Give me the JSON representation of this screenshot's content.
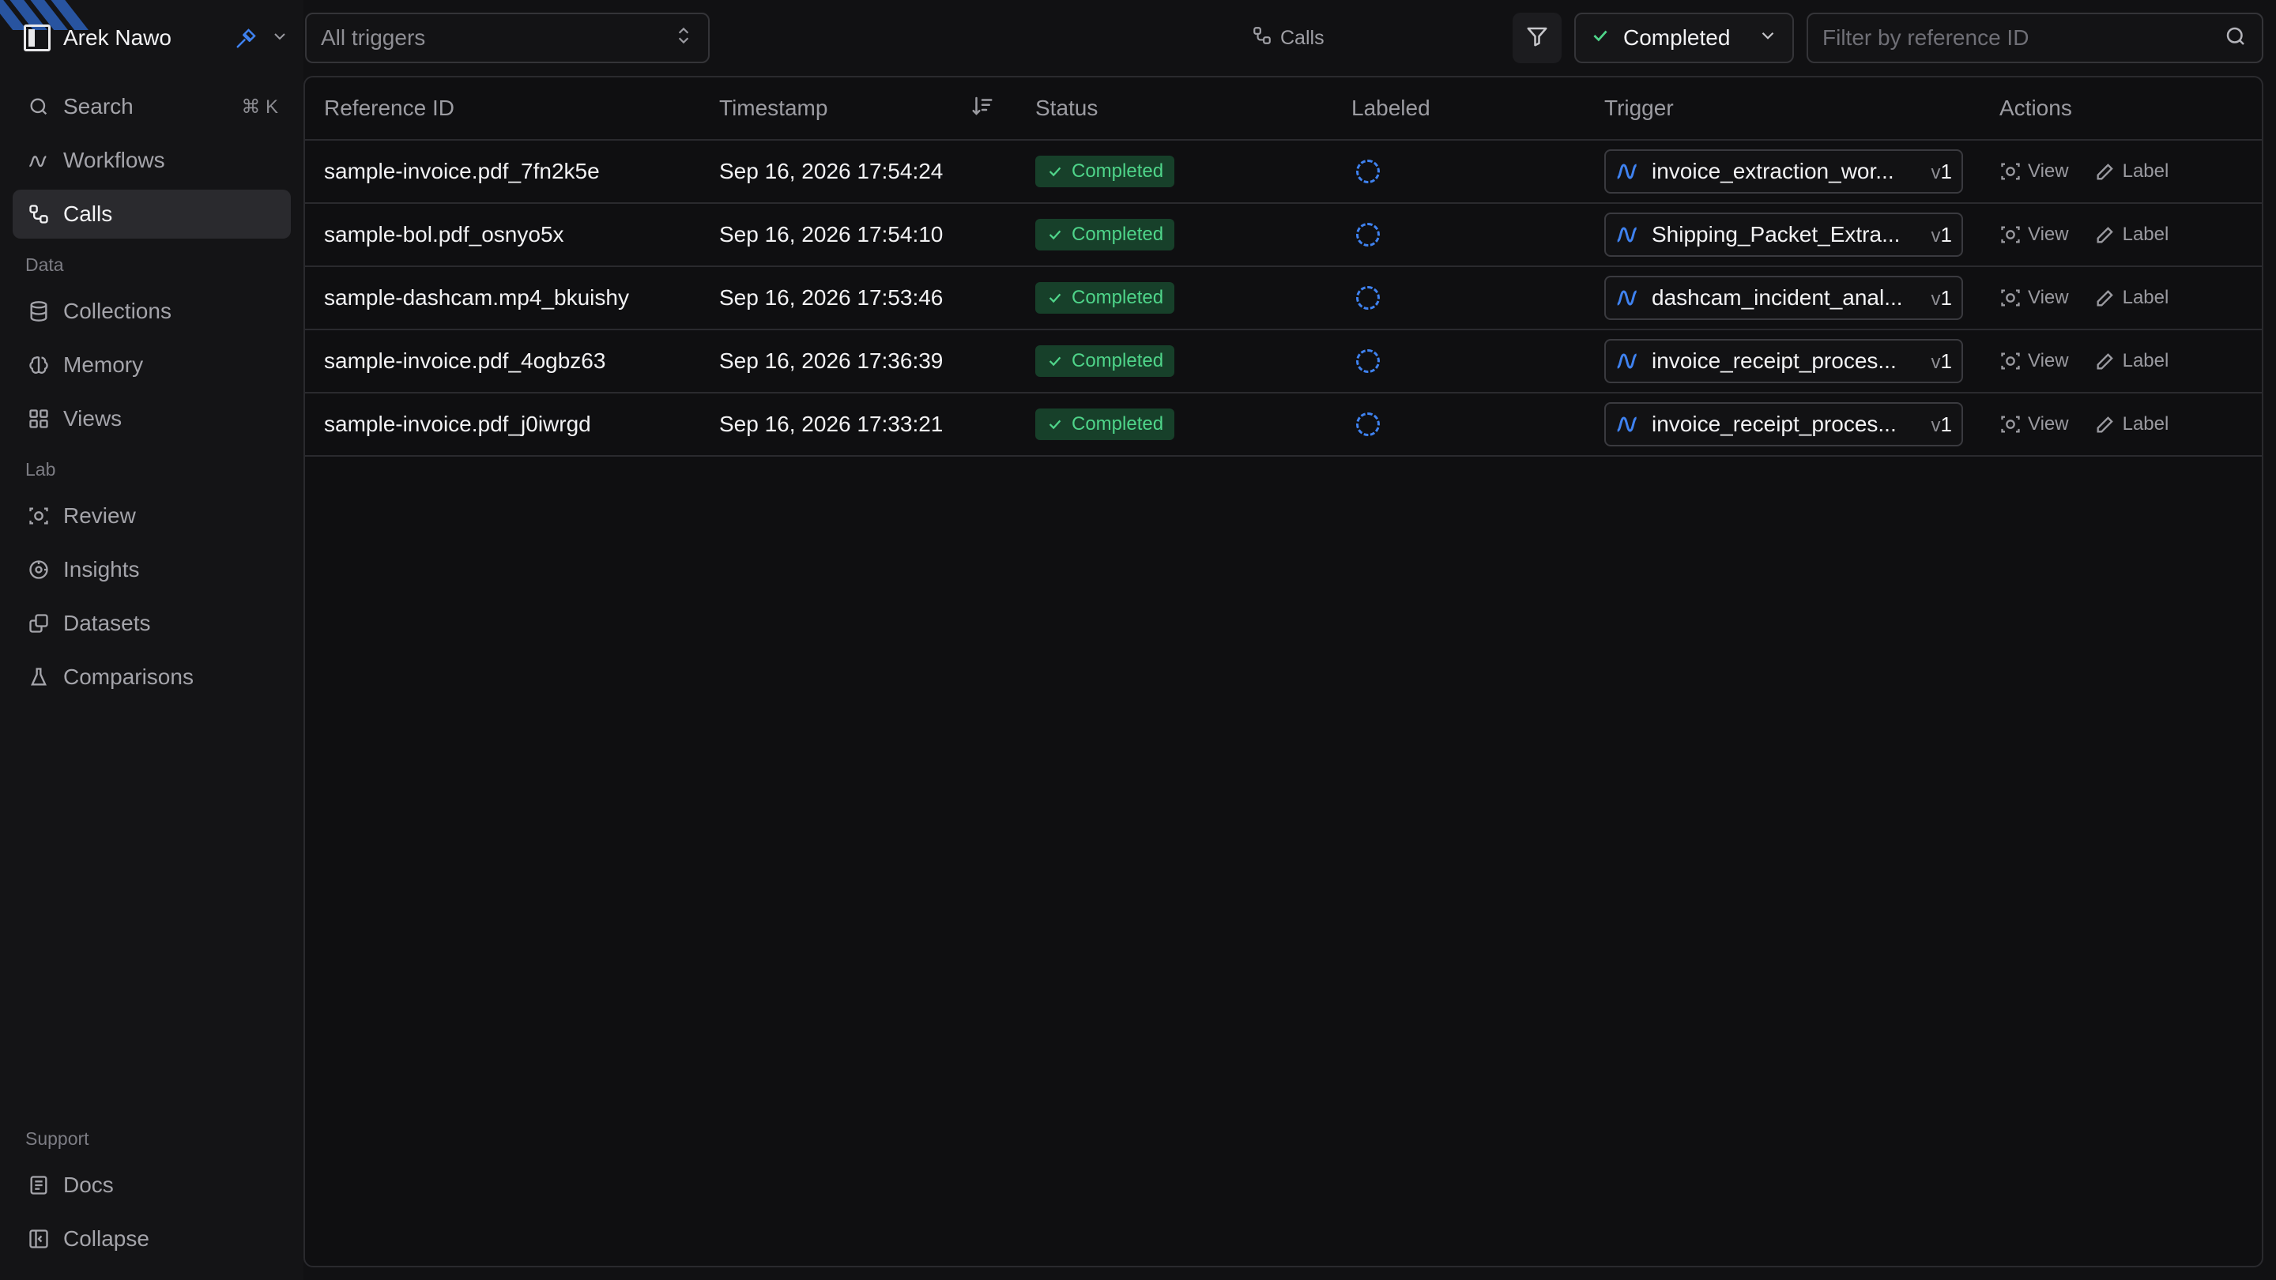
{
  "workspace": {
    "name": "Arek Nawo"
  },
  "sidebar": {
    "search": {
      "label": "Search",
      "shortcut": "⌘ K"
    },
    "main_items": [
      {
        "label": "Workflows",
        "icon": "workflow-icon"
      },
      {
        "label": "Calls",
        "icon": "calls-icon",
        "active": true
      }
    ],
    "sections": [
      {
        "title": "Data",
        "items": [
          {
            "label": "Collections",
            "icon": "database-icon"
          },
          {
            "label": "Memory",
            "icon": "memory-icon"
          },
          {
            "label": "Views",
            "icon": "grid-icon"
          }
        ]
      },
      {
        "title": "Lab",
        "items": [
          {
            "label": "Review",
            "icon": "review-icon"
          },
          {
            "label": "Insights",
            "icon": "insights-icon"
          },
          {
            "label": "Datasets",
            "icon": "datasets-icon"
          },
          {
            "label": "Comparisons",
            "icon": "flask-icon"
          }
        ]
      }
    ],
    "support": {
      "title": "Support",
      "docs": "Docs",
      "collapse": "Collapse"
    }
  },
  "toolbar": {
    "trigger_select": "All triggers",
    "breadcrumb": "Calls",
    "status_select": "Completed",
    "search_placeholder": "Filter by reference ID"
  },
  "table": {
    "columns": [
      "Reference ID",
      "Timestamp",
      "Status",
      "Labeled",
      "Trigger",
      "Actions"
    ],
    "action_view": "View",
    "action_label": "Label",
    "rows": [
      {
        "ref": "sample-invoice.pdf_7fn2k5e",
        "timestamp": "Sep 16, 2026 17:54:24",
        "status": "Completed",
        "trigger": "invoice_extraction_wor...",
        "version": "1"
      },
      {
        "ref": "sample-bol.pdf_osnyo5x",
        "timestamp": "Sep 16, 2026 17:54:10",
        "status": "Completed",
        "trigger": "Shipping_Packet_Extra...",
        "version": "1"
      },
      {
        "ref": "sample-dashcam.mp4_bkuishy",
        "timestamp": "Sep 16, 2026 17:53:46",
        "status": "Completed",
        "trigger": "dashcam_incident_anal...",
        "version": "1"
      },
      {
        "ref": "sample-invoice.pdf_4ogbz63",
        "timestamp": "Sep 16, 2026 17:36:39",
        "status": "Completed",
        "trigger": "invoice_receipt_proces...",
        "version": "1"
      },
      {
        "ref": "sample-invoice.pdf_j0iwrgd",
        "timestamp": "Sep 16, 2026 17:33:21",
        "status": "Completed",
        "trigger": "invoice_receipt_proces...",
        "version": "1"
      }
    ]
  },
  "colors": {
    "accent": "#3f82f0",
    "success": "#4fd58a",
    "success_bg": "#17402a"
  }
}
